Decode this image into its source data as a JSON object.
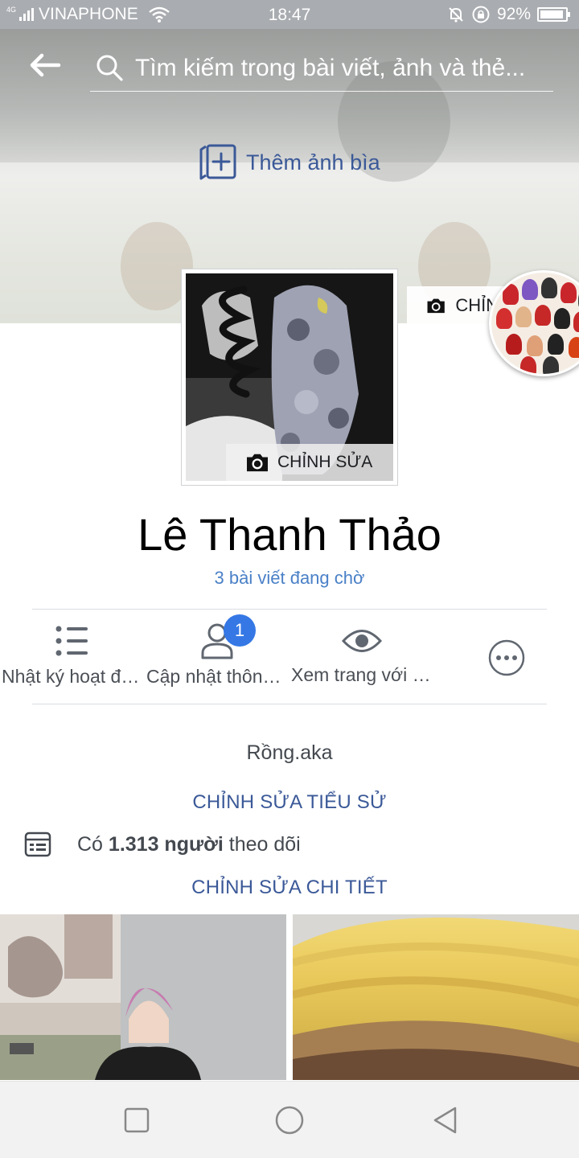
{
  "status_bar": {
    "network": "4G",
    "carrier": "VINAPHONE",
    "time": "18:47",
    "battery_percent": "92%",
    "battery_level": 0.92
  },
  "search": {
    "placeholder": "Tìm kiếm trong bài viết, ảnh và thẻ..."
  },
  "cover": {
    "add_cover_label": "Thêm ảnh bìa",
    "edit_label": "CHỈNH"
  },
  "profile_picture": {
    "edit_label": "CHỈNH SỬA"
  },
  "profile": {
    "name": "Lê Thanh Thảo",
    "pending_posts": "3 bài viết đang chờ"
  },
  "actions": [
    {
      "label": "Nhật ký hoạt động",
      "icon": "list-icon"
    },
    {
      "label": "Cập nhật thông tin",
      "icon": "person-icon",
      "badge": "1"
    },
    {
      "label": "Xem trang với tư cách",
      "icon": "eye-icon"
    },
    {
      "label": "",
      "icon": "more-icon"
    }
  ],
  "intro": {
    "bio": "Rồng.aka",
    "edit_bio_label": "CHỈNH SỬA TIỂU SỬ",
    "followers_prefix": "Có",
    "followers_count": "1.313 người",
    "followers_suffix": "theo dõi",
    "edit_details_label": "CHỈNH SỬA CHI TIẾT"
  },
  "colors": {
    "brand_blue": "#3b5998",
    "link_blue": "#4a80c7",
    "badge_blue": "#3578e5"
  }
}
